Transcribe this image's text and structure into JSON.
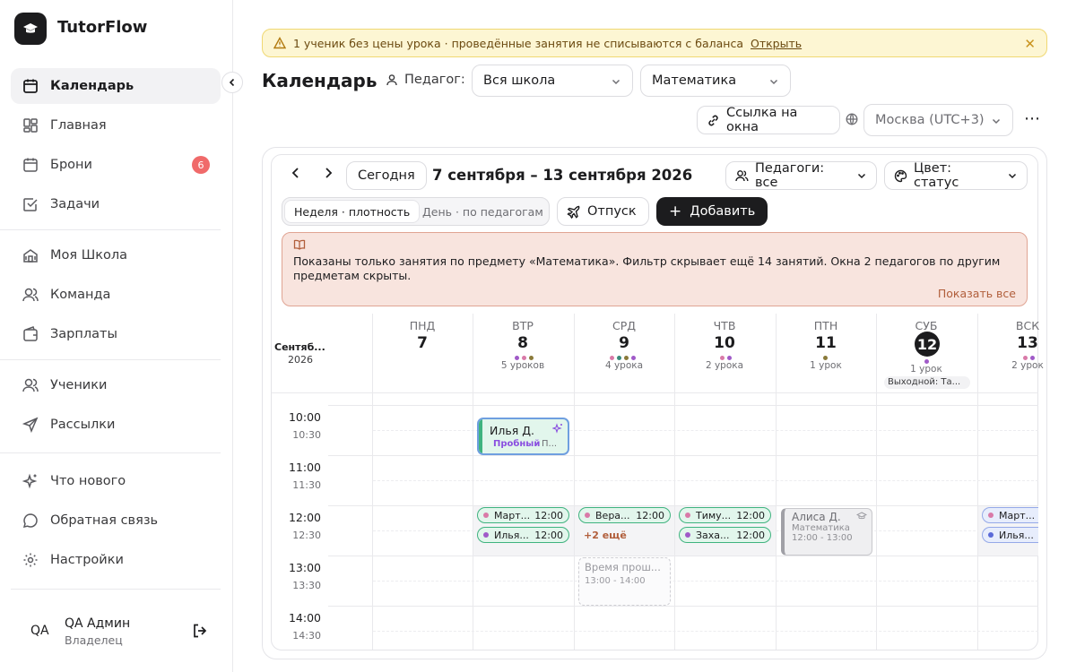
{
  "sidebar": {
    "app_name": "TutorFlow",
    "items": [
      {
        "label": "Календарь"
      },
      {
        "label": "Главная"
      },
      {
        "label": "Брони",
        "badge": "6"
      },
      {
        "label": "Задачи"
      },
      {
        "label": "Моя Школа"
      },
      {
        "label": "Команда"
      },
      {
        "label": "Зарплаты"
      },
      {
        "label": "Ученики"
      },
      {
        "label": "Рассылки"
      },
      {
        "label": "Что нового"
      },
      {
        "label": "Обратная связь"
      },
      {
        "label": "Настройки"
      }
    ],
    "user": {
      "initials": "QA",
      "name": "QA Админ",
      "role": "Владелец"
    }
  },
  "banner": {
    "text": "1 ученик без цены урока · проведённые занятия не списываются с баланса",
    "link": "Открыть"
  },
  "header": {
    "title": "Календарь",
    "teacher_label": "Педагог:",
    "teacher_value": "Вся школа",
    "subject_value": "Математика",
    "slots_link": "Ссылка на окна",
    "timezone": "Москва (UTC+3)"
  },
  "toolbar": {
    "today": "Сегодня",
    "range": "7 сентября – 13 сентября 2026",
    "teachers_filter": "Педагоги: все",
    "color_filter": "Цвет: статус",
    "view_week": "Неделя · плотность",
    "view_day": "День · по педагогам",
    "vacation": "Отпуск",
    "add": "Добавить"
  },
  "notice": {
    "text": "Показаны только занятия по предмету «Математика». Фильтр скрывает ещё 14 занятий. Окна 2 педагогов по другим предметам скрыты.",
    "link": "Показать все"
  },
  "calendar": {
    "month": "Сентяб...",
    "year": "2026",
    "days": [
      {
        "name": "ПНД",
        "num": "7",
        "count": "",
        "dots": []
      },
      {
        "name": "ВТР",
        "num": "8",
        "count": "5 уроков",
        "dots": [
          "#a05ac8",
          "#d97aa8",
          "#8a7a3a"
        ]
      },
      {
        "name": "СРД",
        "num": "9",
        "count": "4 урока",
        "dots": [
          "#d97aa8",
          "#3a8a7a",
          "#8a7a3a",
          "#a05ac8"
        ]
      },
      {
        "name": "ЧТВ",
        "num": "10",
        "count": "2 урока",
        "dots": [
          "#d97aa8",
          "#a05ac8"
        ]
      },
      {
        "name": "ПТН",
        "num": "11",
        "count": "1 урок",
        "dots": [
          "#8a7a3a"
        ]
      },
      {
        "name": "СУБ",
        "num": "12",
        "count": "1 урок",
        "dots": [
          "#a05ac8"
        ],
        "today": true,
        "day_off": "Выходной: Та..."
      },
      {
        "name": "ВСК",
        "num": "13",
        "count": "2 урок",
        "dots": [
          "#d97aa8",
          "#a05ac8"
        ]
      }
    ],
    "times": [
      {
        "main": "10:00",
        "half": "10:30"
      },
      {
        "main": "11:00",
        "half": "11:30"
      },
      {
        "main": "12:00",
        "half": "12:30"
      },
      {
        "main": "13:00",
        "half": "13:30"
      },
      {
        "main": "14:00",
        "half": "14:30"
      }
    ],
    "events": {
      "ilya_trial": {
        "name": "Илья Д.",
        "tag": "Пробный",
        "extra": "П..."
      },
      "tue_1": {
        "name": "Март...",
        "time": "12:00",
        "dot": "#d97aa8"
      },
      "tue_2": {
        "name": "Илья...",
        "time": "12:00",
        "dot": "#a05ac8"
      },
      "wed_1": {
        "name": "Вера...",
        "time": "12:00",
        "dot": "#d97aa8"
      },
      "wed_more": "+2 ещё",
      "wed_past": {
        "title": "Время прош...",
        "time": "13:00 - 14:00"
      },
      "thu_1": {
        "name": "Тиму...",
        "time": "12:00",
        "dot": "#d97aa8"
      },
      "thu_2": {
        "name": "Заха...",
        "time": "12:00",
        "dot": "#a05ac8"
      },
      "fri_1": {
        "name": "Алиса Д.",
        "subject": "Математика",
        "time": "12:00 - 13:00"
      },
      "sun_1": {
        "name": "Март...",
        "dot": "#d97aa8"
      },
      "sun_2": {
        "name": "Илья...",
        "dot": "#5a6ad8"
      }
    }
  },
  "colors": {
    "accent": "#1c1c1e",
    "warning_bg": "#fdf6d3",
    "notice_bg": "#f8e4de",
    "event_green": "#3fb37f"
  }
}
